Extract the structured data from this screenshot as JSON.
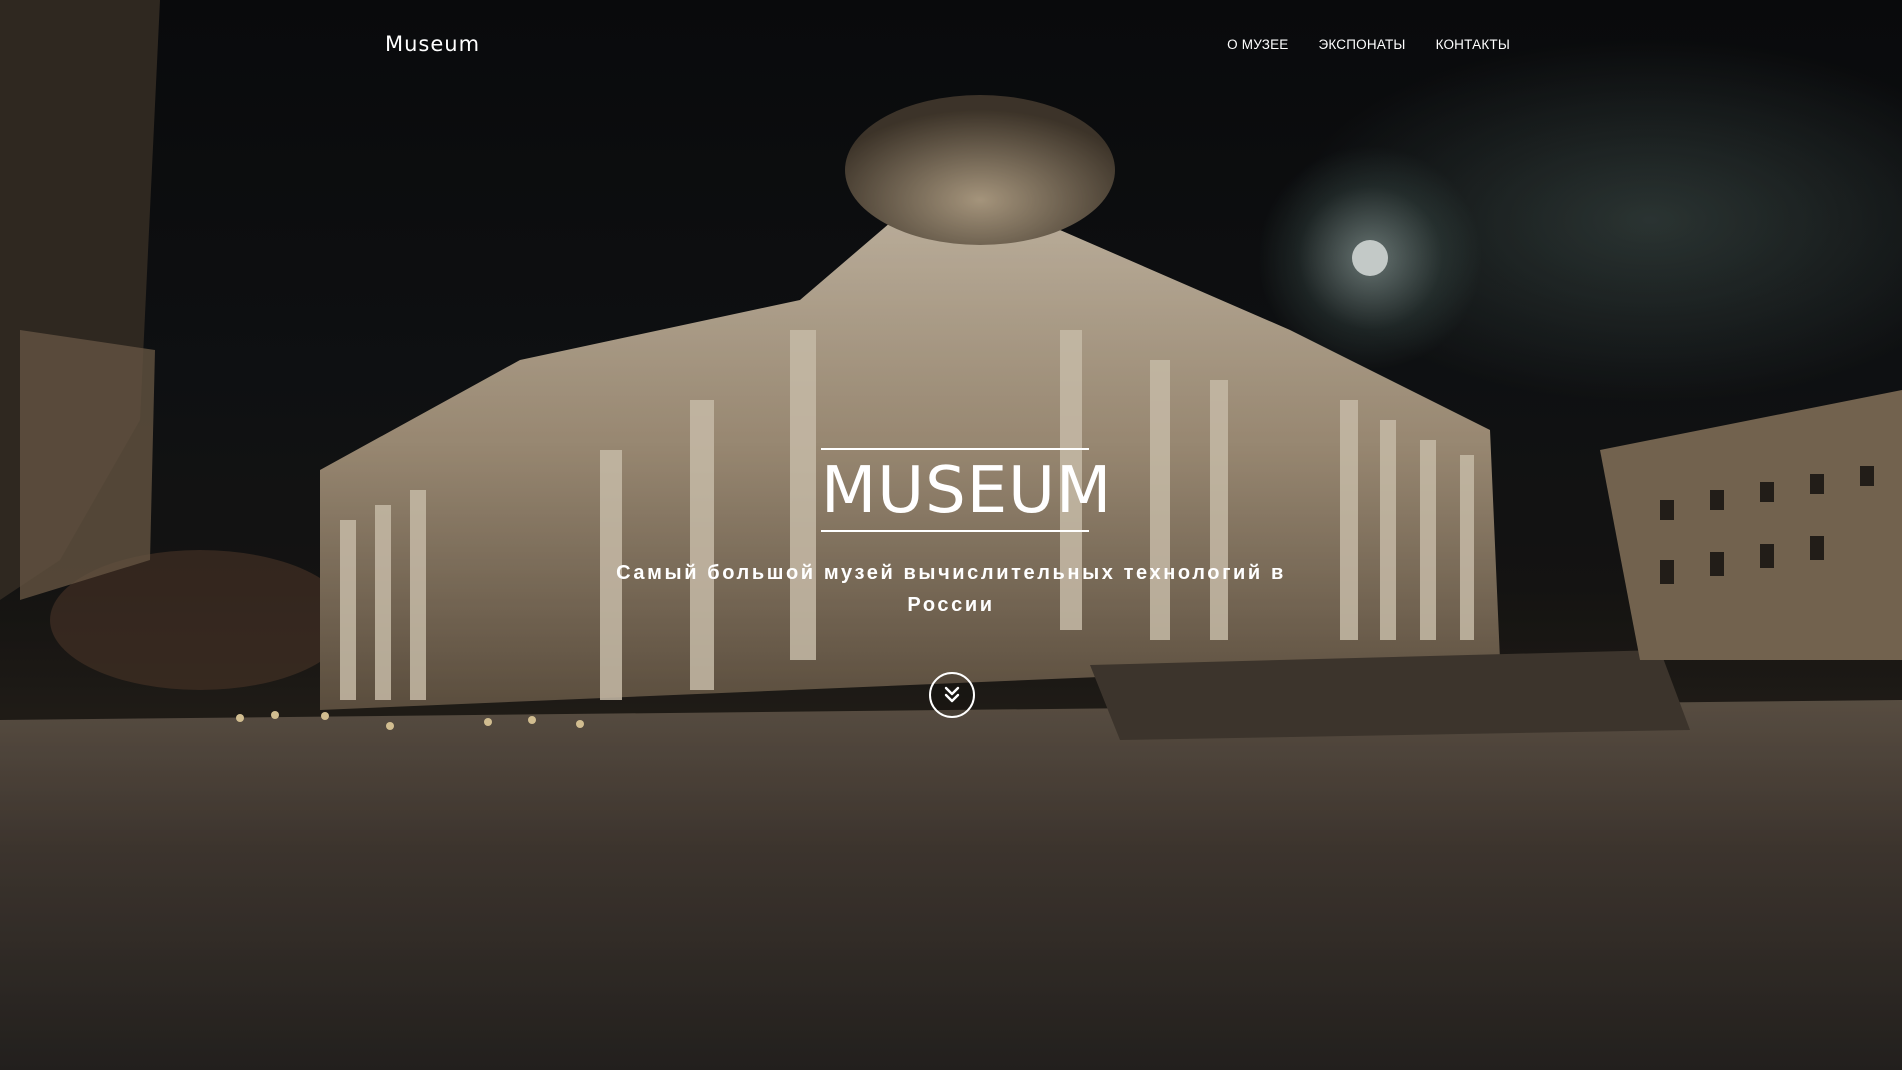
{
  "header": {
    "brand": "Museum",
    "nav": [
      {
        "label": "О МУЗЕЕ"
      },
      {
        "label": "ЭКСПОНАТЫ"
      },
      {
        "label": "КОНТАКТЫ"
      }
    ]
  },
  "hero": {
    "title": "MUSEUM",
    "subtitle": "Самый большой музей вычислительных технологий в России",
    "scroll_icon": "double-chevron-down-icon",
    "background_image": "museum-building-at-night-photo"
  },
  "colors": {
    "text": "#ffffff"
  }
}
